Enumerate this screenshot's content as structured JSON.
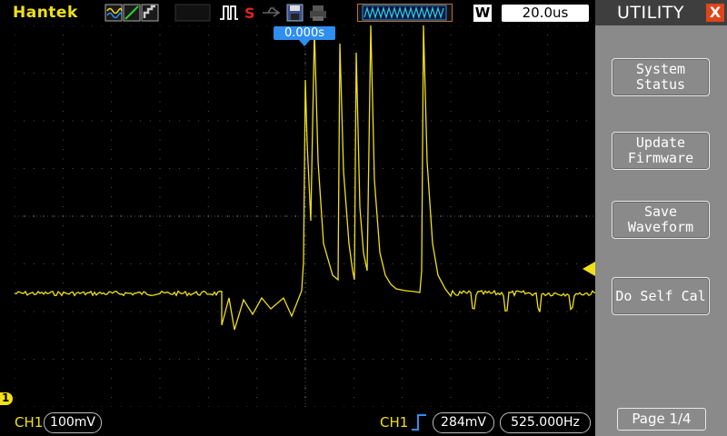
{
  "brand": "Hantek",
  "timebase": {
    "mode": "W",
    "value": "20.0us"
  },
  "trigger_time": "0.000s",
  "menu": {
    "title": "UTILITY",
    "close_label": "X",
    "buttons": [
      {
        "line1": "System",
        "line2": "Status"
      },
      {
        "line1": "Update",
        "line2": "Firmware"
      },
      {
        "line1": "Save",
        "line2": "Waveform"
      },
      {
        "line1": "Do Self Cal",
        "line2": ""
      }
    ],
    "page": "Page 1/4"
  },
  "bottom": {
    "ch1_label": "CH1",
    "ch1_scale": "100mV",
    "trig_source": "CH1",
    "trig_level": "284mV",
    "frequency": "525.000Hz"
  },
  "ch1_marker": "1",
  "colors": {
    "trace": "#f0e018",
    "accent": "#2f8ff0",
    "menu_bg": "#8a8a8a",
    "close": "#e0451a"
  },
  "icons": [
    "waveform-icon",
    "ramp-icon",
    "persist-icon",
    "pulse-trigger-icon",
    "s-icon",
    "usb-icon",
    "save-icon",
    "print-icon",
    "memory-depth-icon"
  ]
}
